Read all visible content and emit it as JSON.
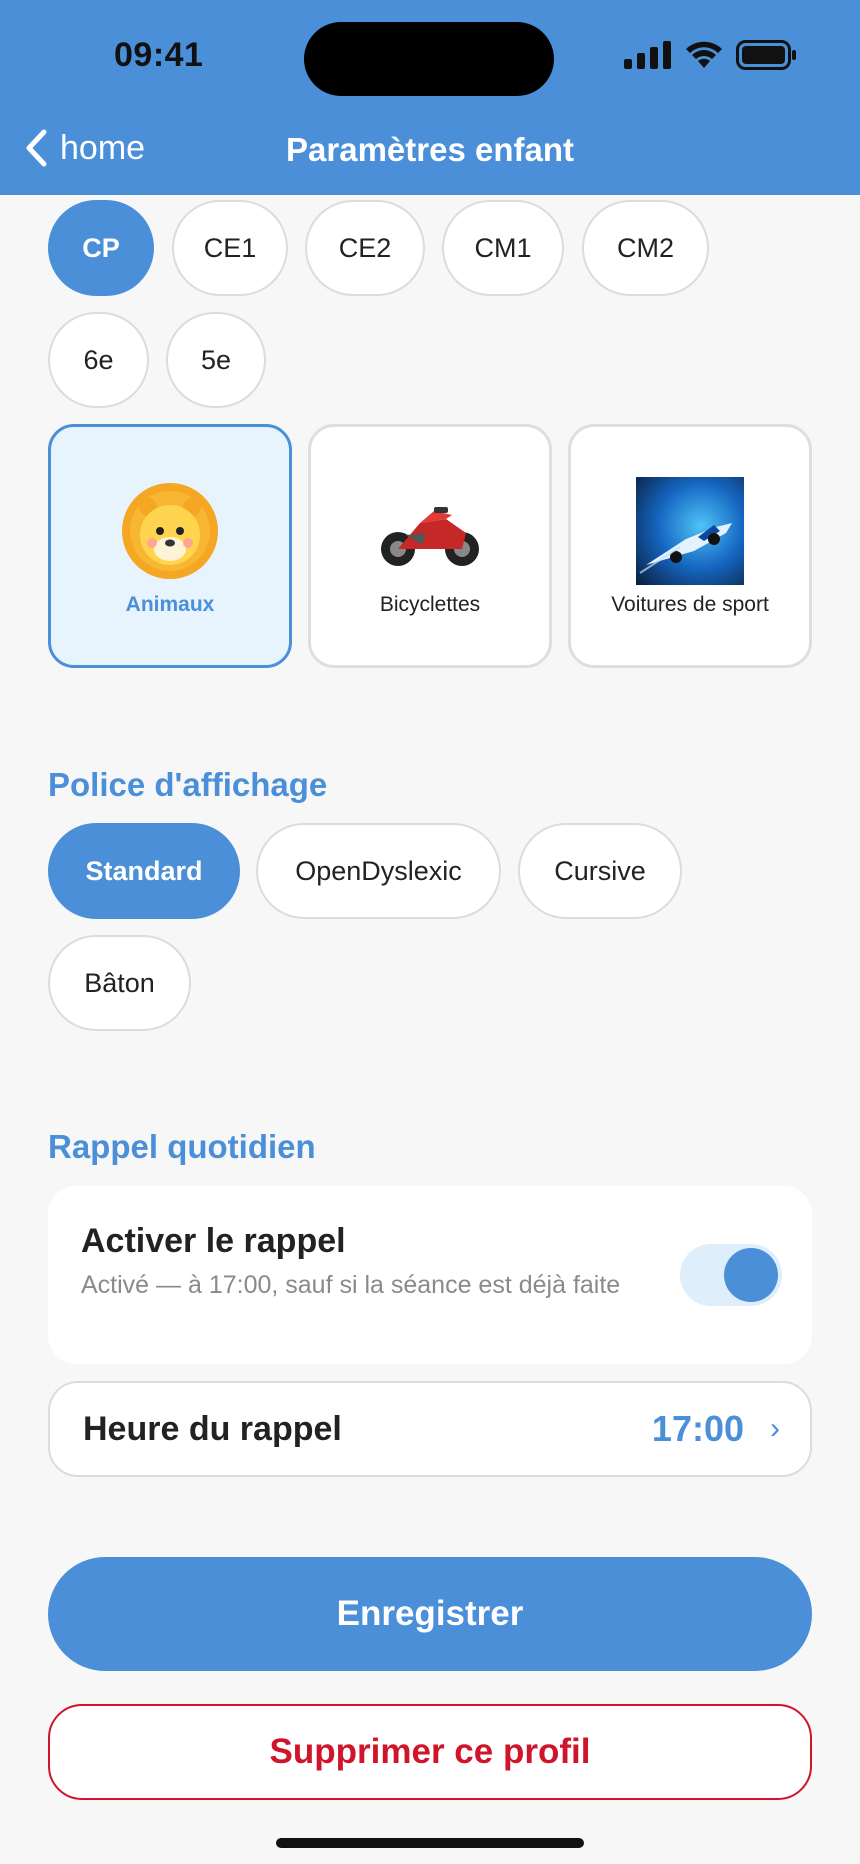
{
  "status_bar": {
    "time": "09:41"
  },
  "nav": {
    "back_label": "home",
    "title": "Paramètres enfant"
  },
  "grades": {
    "selected": "CP",
    "items": [
      "CP",
      "CE1",
      "CE2",
      "CM1",
      "CM2",
      "6e",
      "5e"
    ]
  },
  "themes": {
    "selected": "Animaux",
    "items": [
      {
        "label": "Animaux",
        "icon": "lion-icon"
      },
      {
        "label": "Bicyclettes",
        "icon": "motorcycle-icon"
      },
      {
        "label": "Voitures de sport",
        "icon": "sport-car-icon"
      }
    ]
  },
  "font_section": {
    "title": "Police d'affichage",
    "selected": "Standard",
    "options": [
      "Standard",
      "OpenDyslexic",
      "Cursive",
      "Bâton"
    ]
  },
  "reminder": {
    "section_title": "Rappel quotidien",
    "toggle_title": "Activer le rappel",
    "toggle_subtitle": "Activé — à 17:00, sauf si la séance est déjà faite",
    "enabled": true,
    "time_label": "Heure du rappel",
    "time_value": "17:00",
    "chevron": "›"
  },
  "actions": {
    "save_label": "Enregistrer",
    "delete_label": "Supprimer ce profil"
  },
  "colors": {
    "accent": "#4a8fd8",
    "danger": "#d0142a",
    "background": "#f7f7f7"
  }
}
